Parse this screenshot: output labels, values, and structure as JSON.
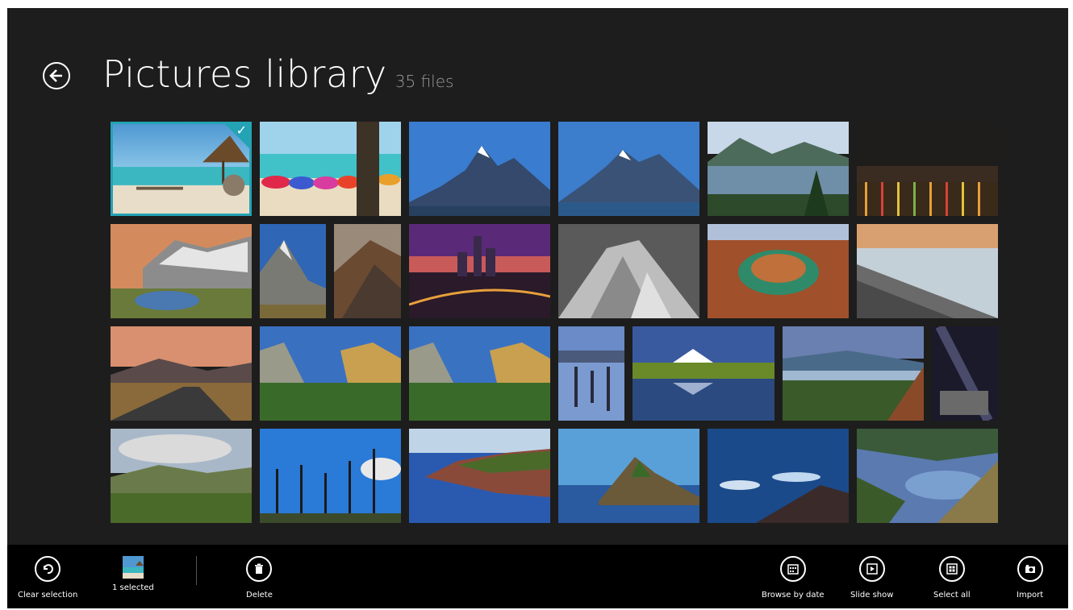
{
  "page": {
    "title": "Pictures library",
    "file_count": "35 files"
  },
  "colors": {
    "background": "#1d1d1d",
    "appbar": "#000000",
    "accent": "#24a3b5",
    "text": "#ffffff",
    "subtext": "#9b9b9b"
  },
  "icons": {
    "back": "back-arrow-icon",
    "check": "checkmark-icon"
  },
  "appbar": {
    "left": [
      {
        "label": "Clear selection",
        "icon": "undo-icon"
      },
      {
        "label": "1 selected",
        "icon": "thumbnail"
      },
      {
        "label": "Delete",
        "icon": "trash-icon"
      }
    ],
    "right": [
      {
        "label": "Browse by date",
        "icon": "calendar-icon"
      },
      {
        "label": "Slide show",
        "icon": "play-icon"
      },
      {
        "label": "Select all",
        "icon": "select-all-icon"
      },
      {
        "label": "Import",
        "icon": "camera-import-icon"
      }
    ]
  },
  "photos": [
    {
      "subject": "beach hut",
      "selected": true
    },
    {
      "subject": "beach kayaks"
    },
    {
      "subject": "mountain range"
    },
    {
      "subject": "mountain range lake"
    },
    {
      "subject": "mountain lake forest"
    },
    {
      "subject": "city lights night"
    },
    {
      "subject": "snowy rocks pond"
    },
    {
      "subject": "mountain peak sky"
    },
    {
      "subject": "rock formation"
    },
    {
      "subject": "city skyline dusk"
    },
    {
      "subject": "volcano black and white"
    },
    {
      "subject": "horseshoe canyon"
    },
    {
      "subject": "rocky coastline"
    },
    {
      "subject": "desert highway"
    },
    {
      "subject": "yosemite valley"
    },
    {
      "subject": "yosemite valley 2"
    },
    {
      "subject": "pier pilings"
    },
    {
      "subject": "snow mountain lake"
    },
    {
      "subject": "river gorge"
    },
    {
      "subject": "milky way"
    },
    {
      "subject": "green valley"
    },
    {
      "subject": "palm trees"
    },
    {
      "subject": "coastal cliffs"
    },
    {
      "subject": "island rock"
    },
    {
      "subject": "waves rocks"
    },
    {
      "subject": "coastal hills"
    }
  ]
}
